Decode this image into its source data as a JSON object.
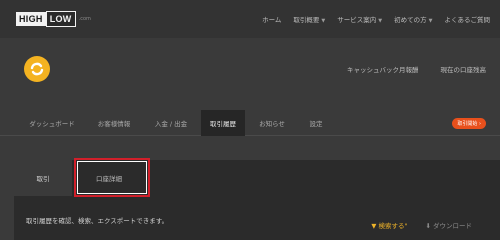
{
  "brand": {
    "high": "HIGH",
    "low": "LOW",
    "suffix": ".com"
  },
  "topnav": [
    {
      "label": "ホーム",
      "has_caret": false
    },
    {
      "label": "取引概要",
      "has_caret": true
    },
    {
      "label": "サービス案内",
      "has_caret": true
    },
    {
      "label": "初めての方",
      "has_caret": true
    },
    {
      "label": "よくあるご質問",
      "has_caret": false
    }
  ],
  "account_links": [
    "キャッシュバック月報酬",
    "現在の口座残高"
  ],
  "tabs": [
    {
      "label": "ダッシュボード",
      "active": false
    },
    {
      "label": "お客様情報",
      "active": false
    },
    {
      "label": "入金 / 出金",
      "active": false
    },
    {
      "label": "取引履歴",
      "active": true
    },
    {
      "label": "お知らせ",
      "active": false
    },
    {
      "label": "設定",
      "active": false
    }
  ],
  "promo_badge": "取引開始 ›",
  "subtabs": {
    "trade": "取引",
    "account": "口座詳細"
  },
  "description": "取引履歴を確認、検索、エクスポートできます。",
  "actions": {
    "search": "▼ 検索する",
    "search_marks": "\"",
    "download": "⬇ ダウンロード"
  },
  "colors": {
    "accent": "#f4b321",
    "highlight": "#d11f2a",
    "promo": "#e8501c"
  }
}
